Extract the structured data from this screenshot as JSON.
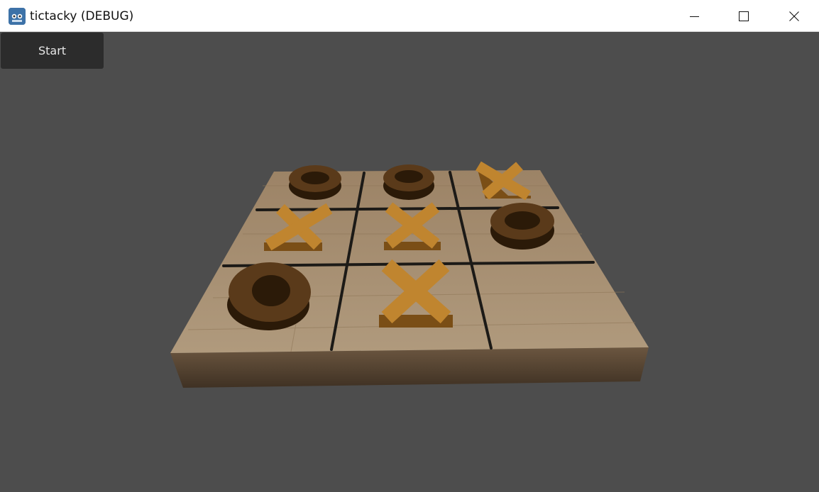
{
  "window": {
    "title": "tictacky (DEBUG)",
    "controls": {
      "minimize": "minimize-icon",
      "maximize": "maximize-icon",
      "close": "close-icon"
    }
  },
  "ui": {
    "start_label": "Start"
  },
  "colors": {
    "background": "#4d4d4d",
    "board_top": "#a89072",
    "board_side": "#5a4834",
    "grid_line": "#1c1a17",
    "x_piece": "#c0852f",
    "o_piece": "#4a3016"
  },
  "board": {
    "cells": [
      [
        "O",
        "O",
        "X"
      ],
      [
        "X",
        "X",
        "O"
      ],
      [
        "O",
        "X",
        ""
      ]
    ]
  }
}
